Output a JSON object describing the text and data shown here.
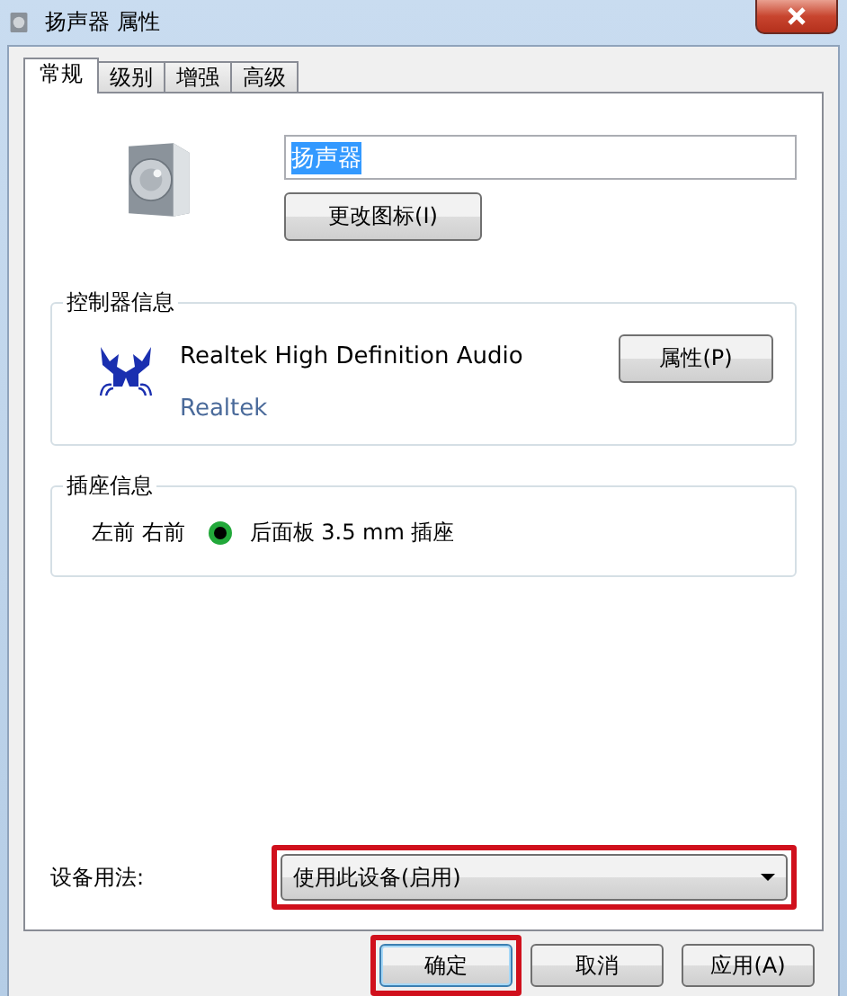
{
  "window": {
    "title": "扬声器 属性"
  },
  "tabs": [
    {
      "label": "常规",
      "selected": true
    },
    {
      "label": "级别",
      "selected": false
    },
    {
      "label": "增强",
      "selected": false
    },
    {
      "label": "高级",
      "selected": false
    }
  ],
  "device": {
    "name": "扬声器",
    "name_selected": true,
    "change_icon_button": "更改图标(I)"
  },
  "controller": {
    "title": "控制器信息",
    "name": "Realtek High Definition Audio",
    "vendor": "Realtek",
    "properties_button": "属性(P)"
  },
  "jacks": {
    "title": "插座信息",
    "items": [
      {
        "channels": "左前 右前",
        "color": "#22a83a",
        "description": "后面板 3.5 mm 插座"
      }
    ]
  },
  "usage": {
    "label": "设备用法:",
    "value": "使用此设备(启用)",
    "highlighted": true
  },
  "buttons": [
    {
      "label": "确定",
      "highlighted": true,
      "default": true
    },
    {
      "label": "取消",
      "highlighted": false,
      "default": false
    },
    {
      "label": "应用(A)",
      "highlighted": false,
      "default": false
    }
  ]
}
